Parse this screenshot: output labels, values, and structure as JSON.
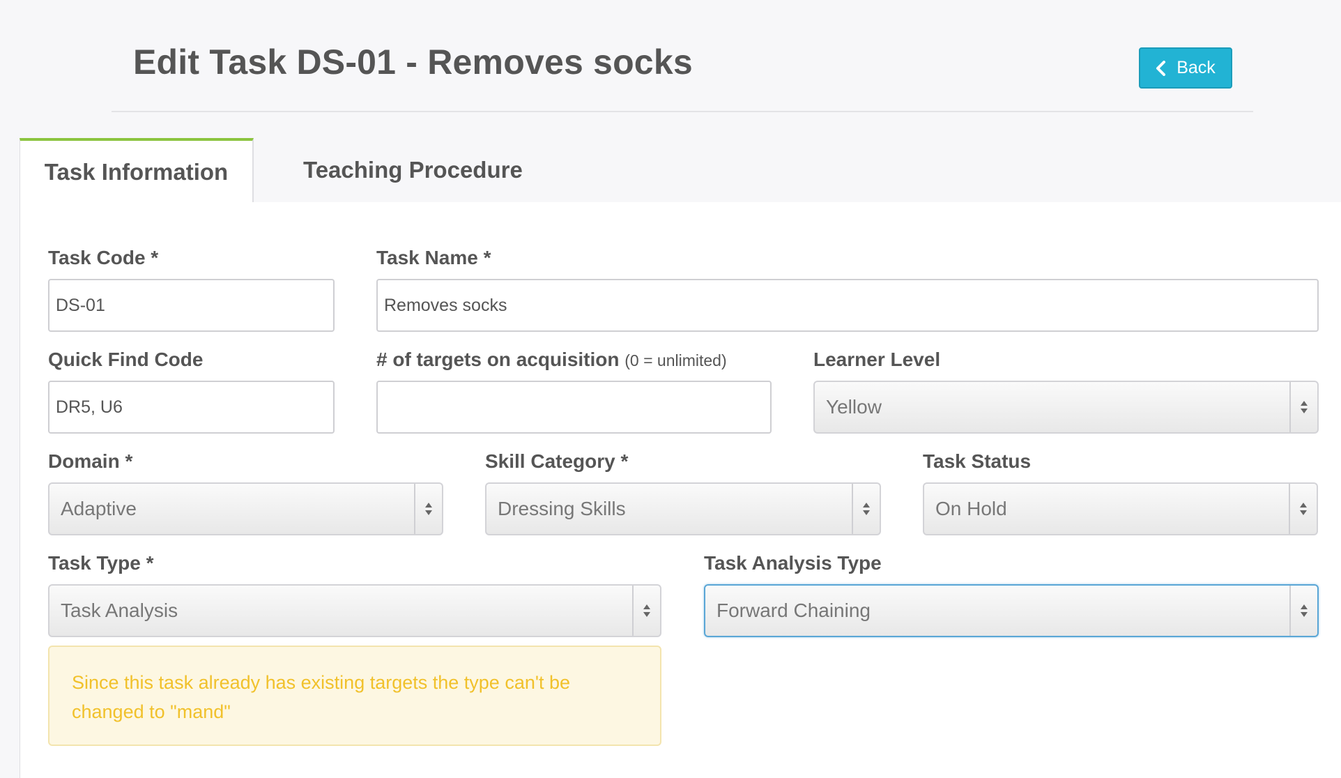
{
  "header": {
    "title": "Edit Task DS-01 - Removes socks",
    "back_label": "Back"
  },
  "tabs": [
    {
      "label": "Task Information",
      "active": true
    },
    {
      "label": "Teaching Procedure",
      "active": false
    }
  ],
  "form": {
    "task_code": {
      "label": "Task Code *",
      "value": "DS-01"
    },
    "task_name": {
      "label": "Task Name *",
      "value": "Removes socks"
    },
    "quick_find_code": {
      "label": "Quick Find Code",
      "value": "DR5, U6"
    },
    "targets_on_acquisition": {
      "label": "# of targets on acquisition",
      "note": "(0 = unlimited)",
      "value": ""
    },
    "learner_level": {
      "label": "Learner Level",
      "value": "Yellow"
    },
    "domain": {
      "label": "Domain *",
      "value": "Adaptive"
    },
    "skill_category": {
      "label": "Skill Category *",
      "value": "Dressing Skills"
    },
    "task_status": {
      "label": "Task Status",
      "value": "On Hold"
    },
    "task_type": {
      "label": "Task Type *",
      "value": "Task Analysis"
    },
    "task_analysis_type": {
      "label": "Task Analysis Type",
      "value": "Forward Chaining"
    }
  },
  "alert": {
    "message": "Since this task already has existing targets the type can't be changed to \"mand\""
  },
  "colors": {
    "accent": "#22b3d4",
    "tab_active": "#8cc43f",
    "warning_text": "#f1c12b",
    "warning_bg": "#fdf7e2"
  }
}
